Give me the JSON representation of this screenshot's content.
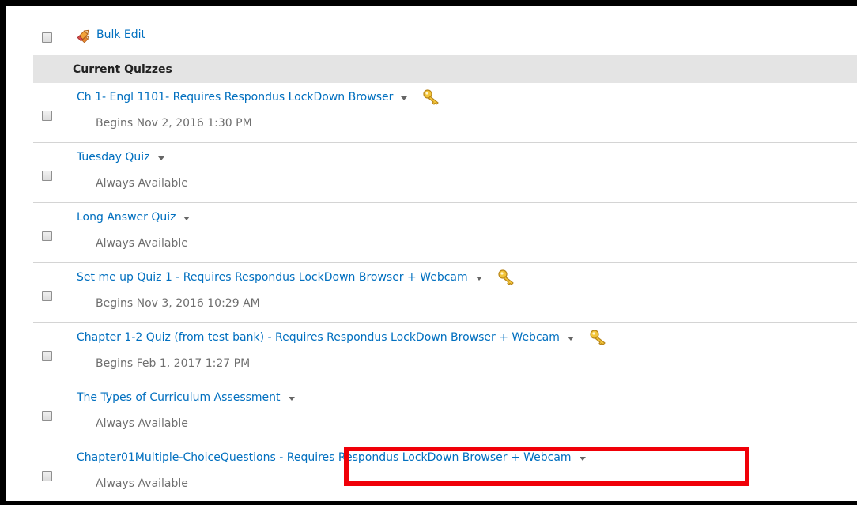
{
  "bulk_edit": {
    "label": "Bulk Edit"
  },
  "section": {
    "title": "Current Quizzes"
  },
  "quizzes": [
    {
      "title": "Ch 1- Engl 1101- Requires Respondus LockDown Browser",
      "availability": "Begins Nov 2, 2016 1:30 PM",
      "has_key": true
    },
    {
      "title": "Tuesday Quiz",
      "availability": "Always Available",
      "has_key": false
    },
    {
      "title": "Long Answer Quiz",
      "availability": "Always Available",
      "has_key": false
    },
    {
      "title": "Set me up Quiz 1 - Requires Respondus LockDown Browser + Webcam",
      "availability": "Begins Nov 3, 2016 10:29 AM",
      "has_key": true
    },
    {
      "title": "Chapter 1-2 Quiz (from test bank) - Requires Respondus LockDown Browser + Webcam",
      "availability": "Begins Feb 1, 2017 1:27 PM",
      "has_key": true
    },
    {
      "title": "The Types of Curriculum Assessment",
      "availability": "Always Available",
      "has_key": false
    },
    {
      "title": "Chapter01Multiple-ChoiceQuestions - Requires Respondus LockDown Browser + Webcam",
      "availability": "Always Available",
      "has_key": false
    }
  ],
  "colors": {
    "link": "#006fbf",
    "highlight": "#f00008",
    "header_bg": "#e4e4e4"
  }
}
